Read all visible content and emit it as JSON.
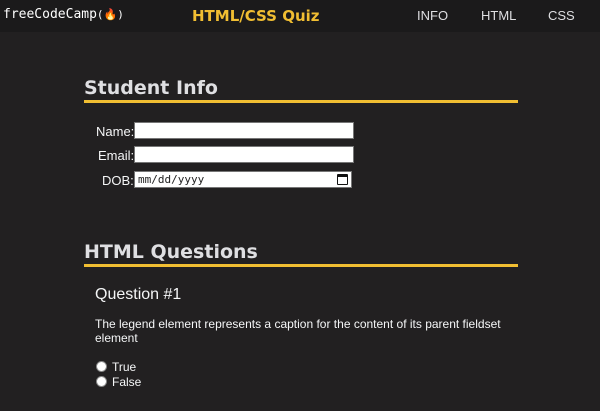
{
  "header": {
    "logo_text": "freeCodeCamp",
    "logo_glyph": "(🔥)",
    "title": "HTML/CSS Quiz",
    "nav": [
      "INFO",
      "HTML",
      "CSS"
    ]
  },
  "student_info": {
    "heading": "Student Info",
    "name_label": "Name:",
    "name_value": "",
    "email_label": "Email:",
    "email_value": "",
    "dob_label": "DOB:",
    "dob_placeholder": "mm/dd/yyyy"
  },
  "html_questions": {
    "heading": "HTML Questions",
    "question_title": "Question #1",
    "question_text": "The legend element represents a caption for the content of its parent fieldset element",
    "options": [
      "True",
      "False"
    ]
  },
  "colors": {
    "accent": "#f1be32",
    "background": "#222021",
    "header_bg": "#1b1a1b",
    "text": "#f5f6f7"
  },
  "icons": [
    "fire-icon",
    "calendar-icon"
  ]
}
